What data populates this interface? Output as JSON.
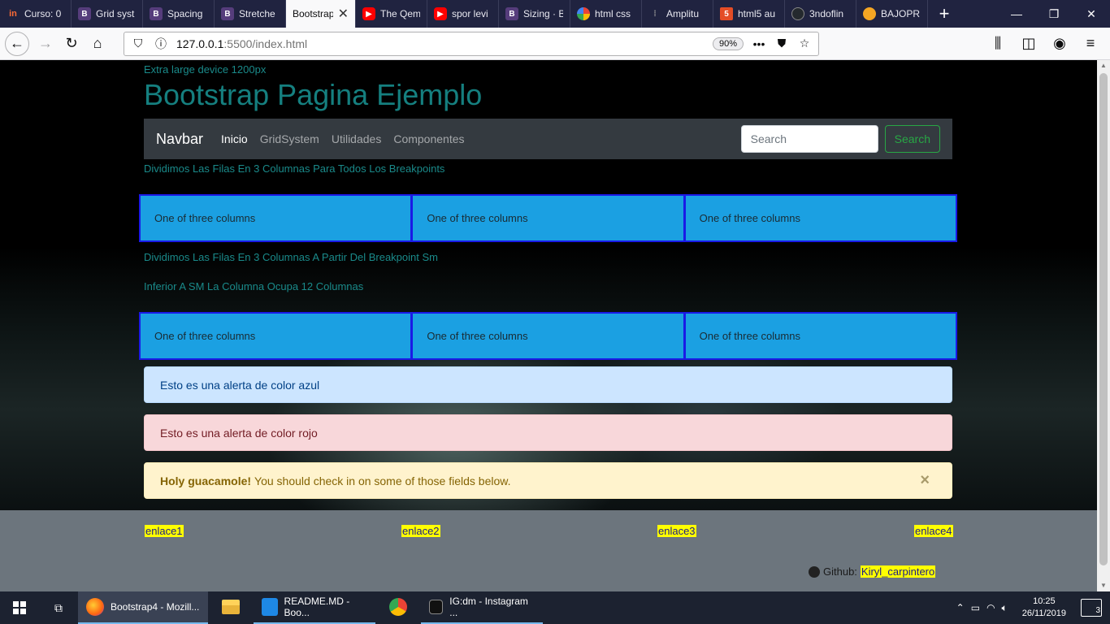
{
  "browser": {
    "tabs": [
      {
        "label": "Curso: 0",
        "icon": "in-icon"
      },
      {
        "label": "Grid syst",
        "icon": "bootstrap-icon"
      },
      {
        "label": "Spacing",
        "icon": "bootstrap-icon"
      },
      {
        "label": "Stretche",
        "icon": "bootstrap-icon"
      },
      {
        "label": "Bootstrap",
        "icon": "bootstrap-icon",
        "active": true
      },
      {
        "label": "The Qem",
        "icon": "youtube-icon"
      },
      {
        "label": "spor levi",
        "icon": "youtube-icon"
      },
      {
        "label": "Sizing · B",
        "icon": "bootstrap-icon"
      },
      {
        "label": "html css",
        "icon": "google-icon"
      },
      {
        "label": "Amplitu",
        "icon": "amplitude-icon"
      },
      {
        "label": "html5 au",
        "icon": "html5-icon"
      },
      {
        "label": "3ndoflin",
        "icon": "github-icon"
      },
      {
        "label": "BAJOPRI",
        "icon": "bajopri-icon"
      }
    ],
    "url_host": "127.0.0.1",
    "url_path": ":5500/index.html",
    "zoom": "90%"
  },
  "page": {
    "device_label": "Extra large device 1200px",
    "title": "Bootstrap Pagina Ejemplo",
    "navbar": {
      "brand": "Navbar",
      "links": [
        "Inicio",
        "GridSystem",
        "Utilidades",
        "Componentes"
      ],
      "search_placeholder": "Search",
      "search_button": "Search"
    },
    "section1_heading": "Dividimos Las Filas En 3 Columnas Para Todos Los Breakpoints",
    "row1": [
      "One of three columns",
      "One of three columns",
      "One of three columns"
    ],
    "section2_heading": "Dividimos Las Filas En 3 Columnas A Partir Del Breakpoint Sm",
    "section2_subheading": "Inferior A SM La Columna Ocupa 12 Columnas",
    "row2": [
      "One of three columns",
      "One of three columns",
      "One of three columns"
    ],
    "alert_blue": "Esto es una alerta de color azul",
    "alert_red": "Esto es una alerta de color rojo",
    "alert_warning": {
      "strong": "Holy guacamole!",
      "text": "You should check in on some of those fields below.",
      "close": "×"
    },
    "footer": {
      "links": [
        "enlace1",
        "enlace2",
        "enlace3",
        "enlace4"
      ],
      "github_label": "Github:",
      "github_handle": "Kiryl_carpintero"
    }
  },
  "taskbar": {
    "apps": [
      {
        "label": "Bootstrap4 - Mozill...",
        "icon": "firefox-icon"
      },
      {
        "label": "",
        "icon": "file-explorer-icon"
      },
      {
        "label": "README.MD - Boo...",
        "icon": "vscode-icon"
      },
      {
        "label": "",
        "icon": "chrome-icon"
      },
      {
        "label": "IG:dm - Instagram ...",
        "icon": "instagram-icon"
      }
    ],
    "time": "10:25",
    "date": "26/11/2019",
    "notifications": "3"
  },
  "colors": {
    "column_bg": "#1ba0e2",
    "column_border": "#1a1ae6",
    "heading_teal": "#157f7f",
    "navbar_bg": "#343a40",
    "footer_bg": "#6c757d",
    "link_highlight": "#ffff00"
  }
}
